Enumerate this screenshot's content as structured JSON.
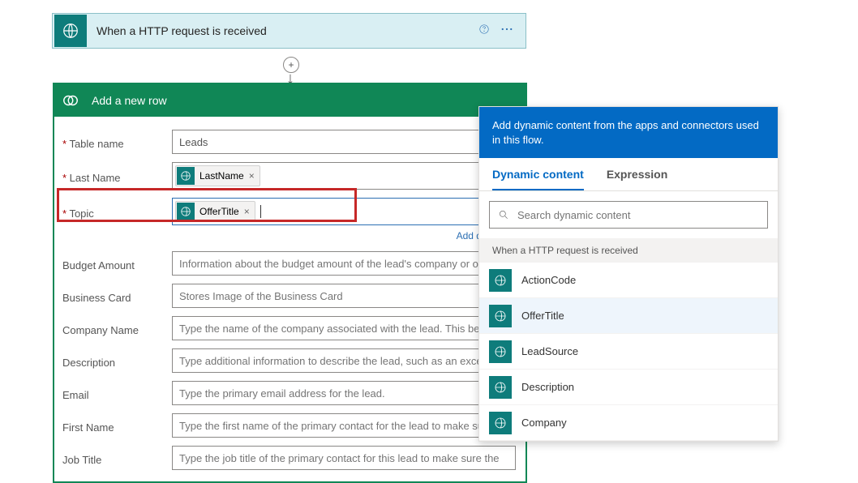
{
  "trigger": {
    "title": "When a HTTP request is received"
  },
  "action": {
    "title": "Add a new row"
  },
  "fields": {
    "table_name_label": "Table name",
    "table_name_value": "Leads",
    "last_name_label": "Last Name",
    "last_name_token": "LastName",
    "topic_label": "Topic",
    "topic_token": "OfferTitle",
    "budget_label": "Budget Amount",
    "budget_placeholder": "Information about the budget amount of the lead's company or organ",
    "bizcard_label": "Business Card",
    "bizcard_placeholder": "Stores Image of the Business Card",
    "company_label": "Company Name",
    "company_placeholder": "Type the name of the company associated with the lead. This become",
    "desc_label": "Description",
    "desc_placeholder": "Type additional information to describe the lead, such as an excerpt fr",
    "email_label": "Email",
    "email_placeholder": "Type the primary email address for the lead.",
    "firstname_label": "First Name",
    "firstname_placeholder": "Type the first name of the primary contact for the lead to make sure tl",
    "jobtitle_label": "Job Title",
    "jobtitle_placeholder": "Type the job title of the primary contact for this lead to make sure the"
  },
  "links": {
    "add_dynamic": "Add dynamic"
  },
  "dyn": {
    "banner": "Add dynamic content from the apps and connectors used in this flow.",
    "tab_dynamic": "Dynamic content",
    "tab_expression": "Expression",
    "search_placeholder": "Search dynamic content",
    "section": "When a HTTP request is received",
    "items": {
      "actioncode": "ActionCode",
      "offertitle": "OfferTitle",
      "leadsource": "LeadSource",
      "description": "Description",
      "company": "Company"
    }
  }
}
